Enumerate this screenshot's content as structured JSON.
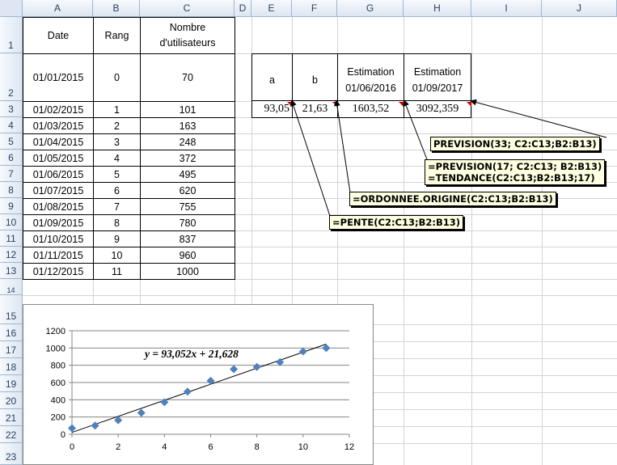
{
  "columns": [
    "A",
    "B",
    "C",
    "D",
    "E",
    "F",
    "G",
    "H",
    "I",
    "J"
  ],
  "rows": [
    "1",
    "2",
    "3",
    "4",
    "5",
    "6",
    "7",
    "8",
    "9",
    "10",
    "11",
    "12",
    "13",
    "14",
    "15",
    "16",
    "17",
    "18",
    "19",
    "20",
    "21",
    "22",
    "23"
  ],
  "table": {
    "headers": [
      "Date",
      "Rang",
      "Nombre\nd'utilisateurs"
    ],
    "data": [
      [
        "01/01/2015",
        "0",
        "70"
      ],
      [
        "01/02/2015",
        "1",
        "101"
      ],
      [
        "01/03/2015",
        "2",
        "163"
      ],
      [
        "01/04/2015",
        "3",
        "248"
      ],
      [
        "01/05/2015",
        "4",
        "372"
      ],
      [
        "01/06/2015",
        "5",
        "495"
      ],
      [
        "01/07/2015",
        "6",
        "620"
      ],
      [
        "01/08/2015",
        "7",
        "755"
      ],
      [
        "01/09/2015",
        "8",
        "780"
      ],
      [
        "01/10/2015",
        "9",
        "837"
      ],
      [
        "01/11/2015",
        "10",
        "960"
      ],
      [
        "01/12/2015",
        "11",
        "1000"
      ]
    ]
  },
  "results": {
    "headers": [
      "a",
      "b",
      "Estimation\n01/06/2016",
      "Estimation\n01/09/2017"
    ],
    "values": [
      "93,05",
      "21,63",
      "1603,52",
      "3092,359"
    ]
  },
  "comments": {
    "prevision": "PREVISION(33; C2:C13;B2:B13)",
    "prevision17": "=PREVISION(17; C2:C13; B2:B13)",
    "tendance": "=TENDANCE(C2:C13;B2:B13;17)",
    "ordonnee": "=ORDONNEE.ORIGINE(C2:C13;B2:B13)",
    "pente": "=PENTE(C2:C13;B2:B13)"
  },
  "chart_data": {
    "type": "scatter",
    "title": "",
    "xlabel": "",
    "ylabel": "",
    "x": [
      0,
      1,
      2,
      3,
      4,
      5,
      6,
      7,
      8,
      9,
      10,
      11
    ],
    "y": [
      70,
      101,
      163,
      248,
      372,
      495,
      620,
      755,
      780,
      837,
      960,
      1000
    ],
    "xlim": [
      0,
      12
    ],
    "ylim": [
      0,
      1200
    ],
    "xticks": [
      0,
      2,
      4,
      6,
      8,
      10,
      12
    ],
    "yticks": [
      0,
      200,
      400,
      600,
      800,
      1000,
      1200
    ],
    "trendline": {
      "slope": 93.052,
      "intercept": 21.628
    },
    "equation_label": "y = 93,052x + 21,628",
    "marker_color": "#4f81bd",
    "line_color": "#000000",
    "grid": true
  }
}
